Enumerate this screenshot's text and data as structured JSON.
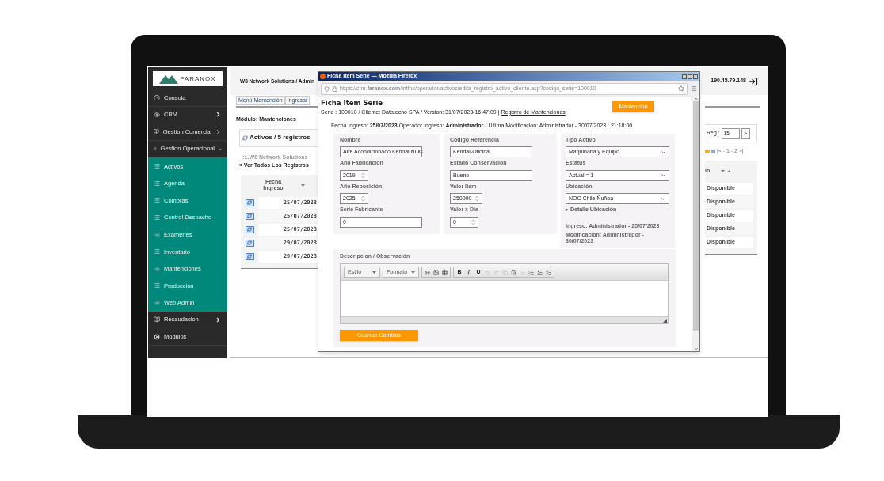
{
  "sidebar": {
    "logo": "FARANOX",
    "items": [
      {
        "label": "Consola",
        "kind": "link"
      },
      {
        "label": "CRM",
        "kind": "group",
        "expanded": false
      },
      {
        "label": "Gestion Comercial",
        "kind": "group",
        "expanded": false
      },
      {
        "label": "Gestion Operacional",
        "kind": "group",
        "expanded": true,
        "children": [
          {
            "label": "Activos"
          },
          {
            "label": "Agenda"
          },
          {
            "label": "Compras"
          },
          {
            "label": "Control Despacho"
          },
          {
            "label": "Exámenes"
          },
          {
            "label": "Inventario"
          },
          {
            "label": "Mantenciones"
          },
          {
            "label": "Produccion"
          },
          {
            "label": "Web Admin"
          }
        ]
      },
      {
        "label": "Recaudacion",
        "kind": "group",
        "expanded": false
      },
      {
        "label": "Modulos",
        "kind": "link"
      }
    ]
  },
  "page": {
    "breadcrumb": "W8 Network Solutions / Admin",
    "ip": "190.45.79.148",
    "tabs": [
      "Menú Mantención",
      "Ingresar"
    ],
    "module_label": "Módulo: Mantenciones",
    "panel_title": "Activos / 5 registros",
    "reg_label": "Reg.:",
    "reg_value": "15",
    "next": ">",
    "pagination": "|« - 1 - 2 »|",
    "links": [
      "::..W8 Network Solutions",
      "» Ver Todos Los Registros"
    ],
    "table": {
      "columns": [
        "Fecha Ingreso",
        "lo"
      ],
      "rows": [
        {
          "date": "25/07/2023",
          "status": "Disponible"
        },
        {
          "date": "25/07/2023",
          "status": "Disponible"
        },
        {
          "date": "25/07/2023",
          "status": "Disponible"
        },
        {
          "date": "29/07/2023",
          "status": "Disponible"
        },
        {
          "date": "29/07/2023",
          "status": "Disponible"
        }
      ]
    }
  },
  "popup": {
    "title": "Ficha Item Serie — Mozilla Firefox",
    "url": "https://crm.**faranox.com**/intfnx/operador/activos/edita_registro_activo_cliente.asp?codigo_serie=100010",
    "heading": "Ficha Item Serie",
    "subline": "Serie : 100010 / Cliente: Datatecno SPA / Version: 31/07/2023-16:47:09 |",
    "subline_link": "Registro de Mantenciones",
    "action_button": "Mantención",
    "info": "Fecha Ingreso: **25/07/2023** Operador Ingreso: **Administrador** - Ultima Modificacion: Administrador - 30/07/2023 : 21:18:00",
    "columns": [
      [
        {
          "label": "Nombre",
          "value": "Aire Acondicionado Kendal NOC",
          "kind": "text"
        },
        {
          "label": "Año Fabricación",
          "value": "2019",
          "kind": "number"
        },
        {
          "label": "Año Reposición",
          "value": "2025",
          "kind": "number"
        },
        {
          "label": "Serie Fabricante",
          "value": "0",
          "kind": "text"
        }
      ],
      [
        {
          "label": "Código Referencia",
          "value": "Kendal-Oficina",
          "kind": "text"
        },
        {
          "label": "Estado Conservación",
          "value": "Bueno",
          "kind": "text"
        },
        {
          "label": "Valor Item",
          "value": "250000",
          "kind": "number"
        },
        {
          "label": "Valor x Día",
          "value": "0",
          "kind": "number"
        }
      ],
      [
        {
          "label": "Tipo Activo",
          "value": "Maquinaria y Equipo",
          "kind": "select"
        },
        {
          "label": "Estatus",
          "value": "Actual = 1",
          "kind": "select"
        },
        {
          "label": "Ubicación",
          "value": "NOC Chile Ñuñoa",
          "kind": "select"
        }
      ]
    ],
    "location_link": "▸ Detalle Ubicación",
    "notes": [
      "Ingreso: Administrador - 25/07/2023",
      "Modificación: Administrador - 30/07/2023"
    ],
    "description_label": "Descripcion / Observación",
    "editor_dropdowns": [
      "Estilo",
      "Formato"
    ],
    "format_buttons": [
      "B",
      "I",
      "U"
    ],
    "save_button": "Guardar Cambios"
  }
}
